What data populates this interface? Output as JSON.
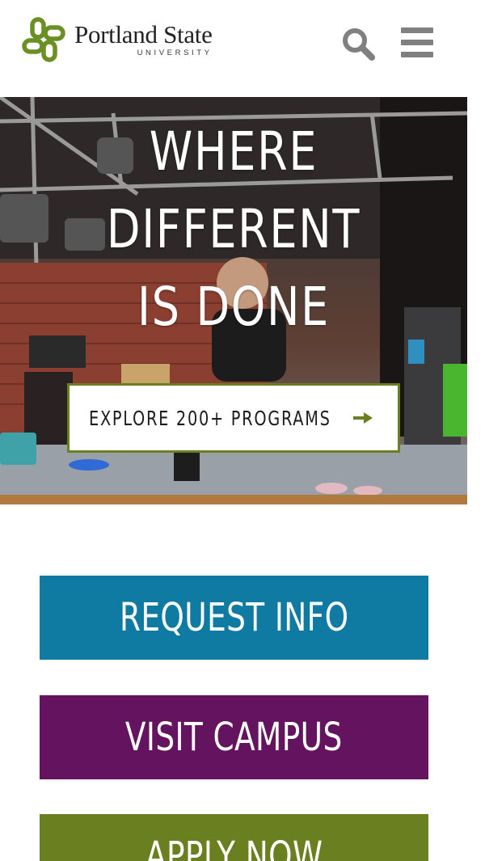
{
  "header": {
    "logo_name": "Portland State",
    "logo_sub": "UNIVERSITY",
    "search_icon": "search-icon",
    "menu_icon": "hamburger-menu-icon",
    "brand_color": "#6a7f1f"
  },
  "hero": {
    "title_lines": [
      "WHERE",
      "DIFFERENT",
      "IS DONE"
    ],
    "cta_label": "EXPLORE 200+ PROGRAMS",
    "cta_icon": "arrow-right-icon"
  },
  "actions": {
    "request_info": "REQUEST INFO",
    "visit_campus": "VISIT CAMPUS",
    "apply_now": "APPLY NOW"
  },
  "colors": {
    "request_info": "#0f7aa2",
    "visit_campus": "#64135e",
    "apply_now": "#6a7f1f"
  }
}
